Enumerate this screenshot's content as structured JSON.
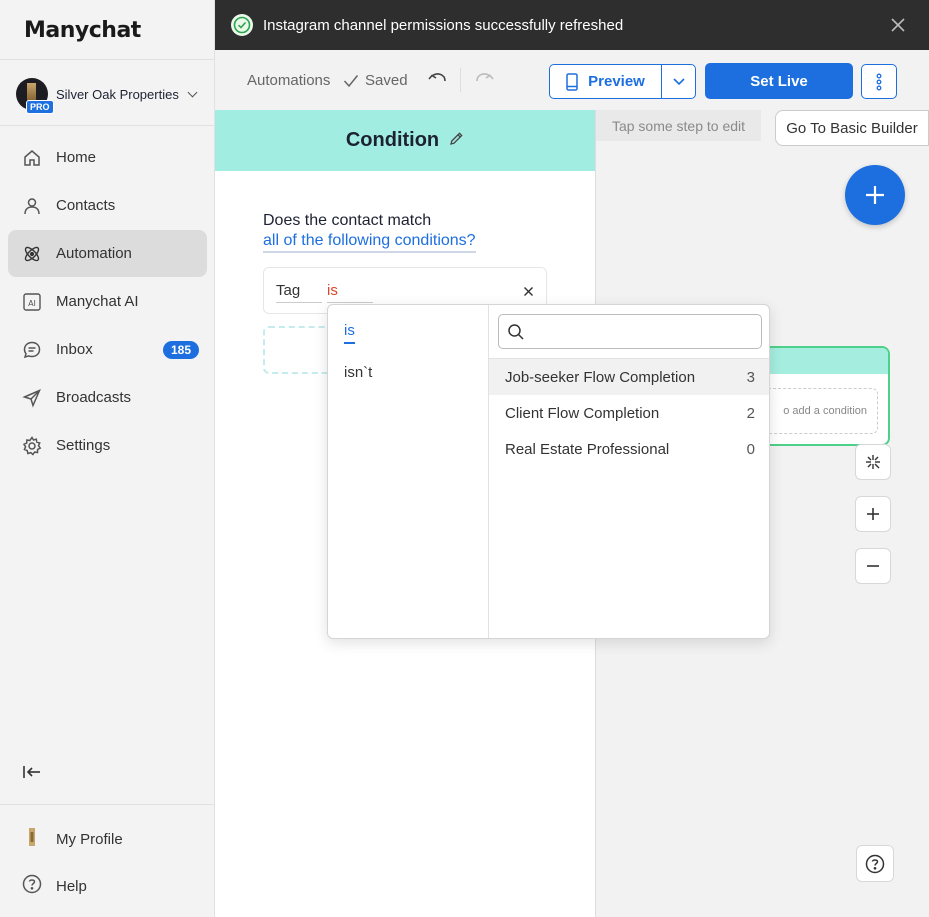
{
  "brand": {
    "logo_text": "Manychat",
    "accent": "#1d6fe0"
  },
  "account": {
    "name": "Silver Oak Properties",
    "plan_badge": "PRO"
  },
  "sidebar": {
    "items": [
      {
        "label": "Home",
        "icon": "home-icon"
      },
      {
        "label": "Contacts",
        "icon": "user-icon"
      },
      {
        "label": "Automation",
        "icon": "atom-icon",
        "active": true
      },
      {
        "label": "Manychat AI",
        "icon": "ai-icon"
      },
      {
        "label": "Inbox",
        "icon": "chat-icon",
        "badge": "185"
      },
      {
        "label": "Broadcasts",
        "icon": "send-icon"
      },
      {
        "label": "Settings",
        "icon": "gear-icon"
      }
    ],
    "my_profile": "My Profile",
    "help": "Help"
  },
  "toast": {
    "message": "Instagram channel permissions successfully refreshed"
  },
  "toolbar": {
    "breadcrumb": "Automations",
    "status": "Saved",
    "preview_label": "Preview",
    "set_live_label": "Set Live"
  },
  "canvas": {
    "hint": "Tap some step to edit",
    "basic_builder_label": "Go To Basic Builder",
    "node_slot_text": "o add a condition"
  },
  "panel": {
    "title": "Condition",
    "question": "Does the contact match",
    "match_link": "all of the following conditions?",
    "condition": {
      "field": "Tag",
      "operator": "is"
    }
  },
  "dropdown": {
    "operators": [
      {
        "label": "is",
        "selected": true
      },
      {
        "label": "isn`t",
        "selected": false
      }
    ],
    "search_placeholder": "",
    "tags": [
      {
        "name": "Job-seeker Flow Completion",
        "count": "3"
      },
      {
        "name": "Client Flow Completion",
        "count": "2"
      },
      {
        "name": "Real Estate Professional",
        "count": "0"
      }
    ]
  }
}
